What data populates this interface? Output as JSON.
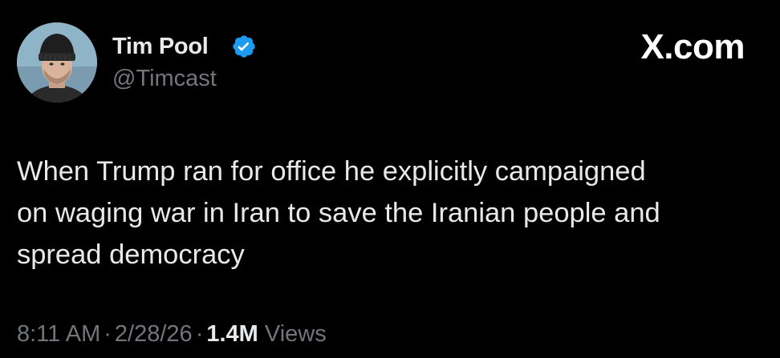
{
  "tweet": {
    "author": {
      "display_name": "Tim Pool",
      "handle": "@Timcast",
      "verified_icon": "verified-badge-icon",
      "avatar": "avatar-icon"
    },
    "brand": "X.com",
    "text": "When Trump ran for office he explicitly campaigned\non waging war in Iran to save the Iranian people and\nspread democracy",
    "meta": {
      "time": "8:11 AM",
      "separator": "·",
      "date": "2/28/26",
      "views_count": "1.4M",
      "views_label": "Views"
    }
  },
  "colors": {
    "background": "#000000",
    "primary_text": "#e7e9ea",
    "secondary_text": "#71767b",
    "verified_blue": "#1d9bf0"
  }
}
